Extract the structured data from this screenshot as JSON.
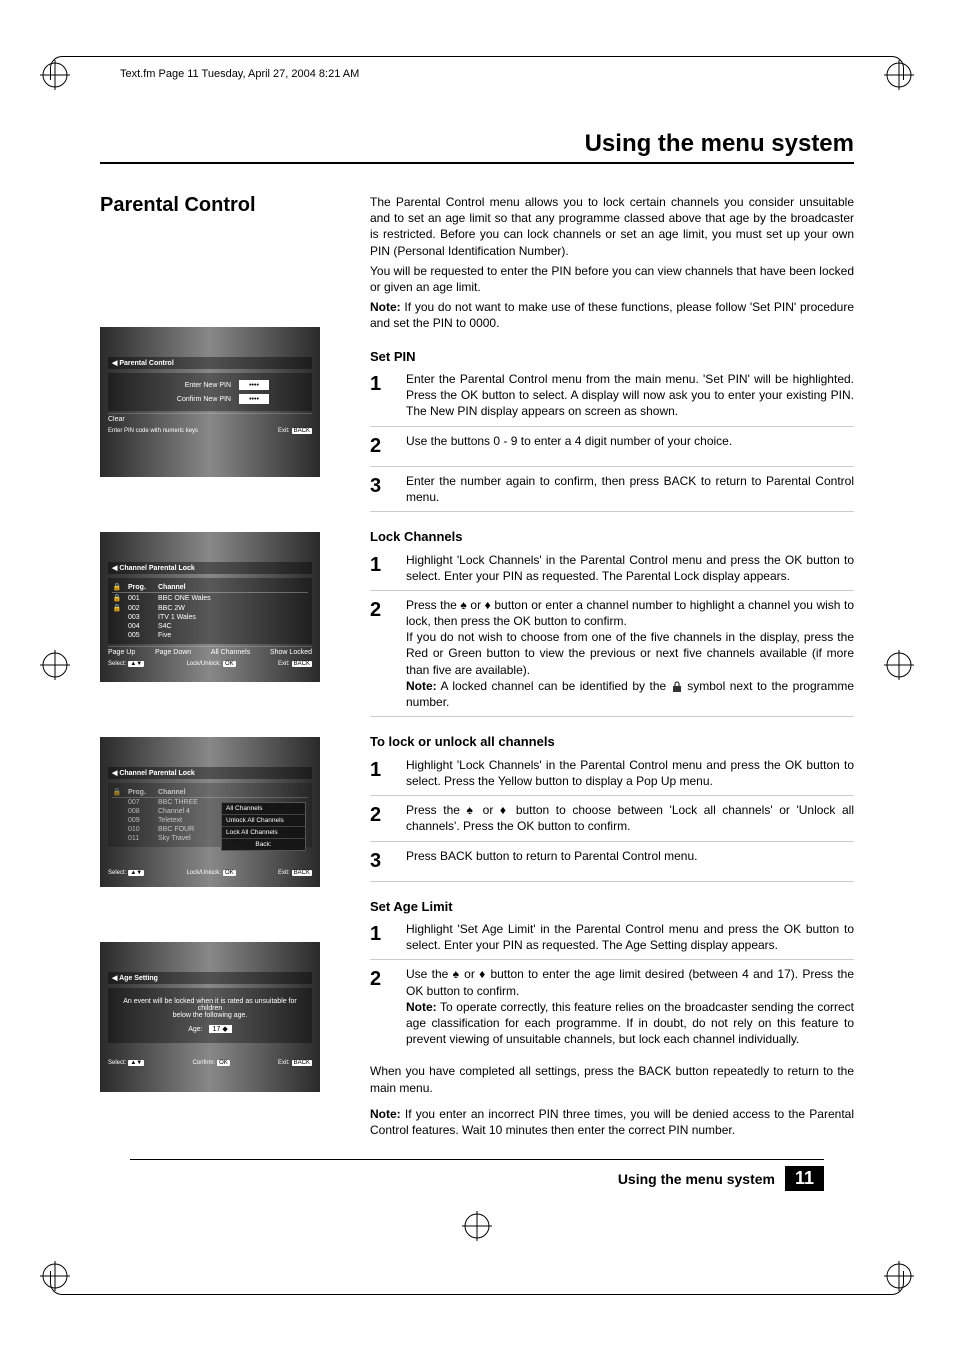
{
  "meta": {
    "header": "Text.fm  Page 11  Tuesday, April 27, 2004  8:21 AM"
  },
  "page_title": "Using the menu system",
  "heading": "Parental Control",
  "intro": {
    "p1": "The Parental Control menu allows you to lock certain channels you consider unsuitable and to set an age limit so that any programme classed above that age by the broadcaster is restricted. Before you can lock channels or set an age limit, you must set up your own PIN (Personal Identification Number).",
    "p2": "You will be requested to enter the PIN before you can view channels that have been locked or given an age limit.",
    "note_label": "Note:",
    "note": " If you do not want to make use of these functions, please follow 'Set PIN' procedure and set the PIN to 0000."
  },
  "sections": {
    "set_pin": {
      "title": "Set PIN",
      "steps": [
        "Enter the Parental Control menu from the main menu. 'Set PIN' will be highlighted. Press the OK button to select. A display will now ask you to enter your existing PIN. The New PIN display appears on screen as shown.",
        "Use the buttons 0 - 9 to enter a 4 digit number of your choice.",
        "Enter the number again to confirm, then press BACK to return to Parental Control menu."
      ]
    },
    "lock_channels": {
      "title": "Lock Channels",
      "steps": [
        "Highlight 'Lock Channels' in the Parental Control menu and press the OK button to select. Enter your PIN as requested. The Parental Lock display appears.",
        "Press the ♠ or ♦ button or enter a channel number to highlight a channel you wish to lock, then press the OK button to confirm.\nIf you do not wish to choose from one of the five channels in the display, press the Red or Green button to view the previous or next five channels available (if more than five are available)."
      ],
      "note_label": "Note:",
      "note_a": " A locked channel can be identified by the ",
      "note_b": " symbol next to the programme number."
    },
    "lock_all": {
      "title": "To lock or unlock all channels",
      "steps": [
        "Highlight 'Lock Channels' in the Parental Control menu and press the OK button to select. Press the Yellow button to display a Pop Up menu.",
        "Press the ♠ or ♦ button to choose between 'Lock all channels' or 'Unlock all channels'. Press the OK button to confirm.",
        "Press BACK button to return to Parental Control menu."
      ]
    },
    "set_age": {
      "title": "Set Age Limit",
      "steps": [
        "Highlight 'Set Age Limit' in the Parental Control menu and press the OK button to select. Enter your PIN as requested. The Age Setting  display appears.",
        "Use the ♠ or ♦ button to enter the age limit desired (between 4 and 17). Press the OK button to confirm."
      ],
      "note_label": "Note:",
      "note": " To operate correctly, this feature relies on the broadcaster sending the correct age classification for each programme. If in doubt, do not rely on this feature to prevent viewing of unsuitable channels, but lock each channel individually."
    }
  },
  "closing": "When you have completed all settings, press the BACK button repeatedly to return to the main menu.",
  "final_note_label": "Note:",
  "final_note": " If you enter an incorrect PIN three times, you will be denied access to the Parental Control features. Wait 10 minutes then enter the correct PIN number.",
  "footer": {
    "label": "Using the menu system",
    "page": "11"
  },
  "shots": {
    "s1": {
      "title": "◀ Parental Control",
      "enter": "Enter New PIN",
      "confirm": "Confirm New PIN",
      "dots": "••••",
      "clear": "Clear",
      "hint": "Enter PIN code with numeric keys",
      "exit": "Exit:",
      "back": "BACK"
    },
    "s2": {
      "title": "◀ Channel Parental Lock",
      "h_lock": "🔒",
      "h_prog": "Prog.",
      "h_chan": "Channel",
      "rows": [
        {
          "lock": "🔒",
          "prog": "001",
          "chan": "BBC ONE Wales"
        },
        {
          "lock": "🔒",
          "prog": "002",
          "chan": "BBC 2W"
        },
        {
          "lock": "",
          "prog": "003",
          "chan": "ITV 1 Wales"
        },
        {
          "lock": "",
          "prog": "004",
          "chan": "S4C"
        },
        {
          "lock": "",
          "prog": "005",
          "chan": "Five"
        }
      ],
      "pu": "Page Up",
      "pd": "Page Down",
      "all": "All Channels",
      "show": "Show Locked",
      "select": "Select:",
      "ud": "▲▼",
      "lu": "Lock/Unlock:",
      "ok": "OK",
      "exit": "Exit:",
      "back": "BACK"
    },
    "s3": {
      "title": "◀ Channel Parental Lock",
      "h_lock": "🔒",
      "h_prog": "Prog.",
      "h_chan": "Channel",
      "rows": [
        {
          "lock": "",
          "prog": "007",
          "chan": "BBC THREE"
        },
        {
          "lock": "",
          "prog": "008",
          "chan": "Channel 4"
        },
        {
          "lock": "",
          "prog": "009",
          "chan": "Teletext"
        },
        {
          "lock": "",
          "prog": "010",
          "chan": "BBC FOUR"
        },
        {
          "lock": "",
          "prog": "011",
          "chan": "Sky Travel"
        }
      ],
      "popup": [
        "All Channels",
        "Unlock All Channels",
        "Lock All Channels"
      ],
      "popup_back": "Back:",
      "select": "Select:",
      "ud": "▲▼",
      "lu": "Lock/Unlock:",
      "ok": "OK",
      "exit": "Exit:",
      "back": "BACK"
    },
    "s4": {
      "title": "◀ Age Setting",
      "line1": "An event will be locked when it is rated as unsuitable for children",
      "line2": "below the following age.",
      "age_label": "Age:",
      "age_val": "17",
      "arrows": "◆",
      "select": "Select:",
      "ud": "▲▼",
      "confirm": "Confirm:",
      "ok": "OK",
      "exit": "Exit:",
      "back": "BACK"
    }
  }
}
